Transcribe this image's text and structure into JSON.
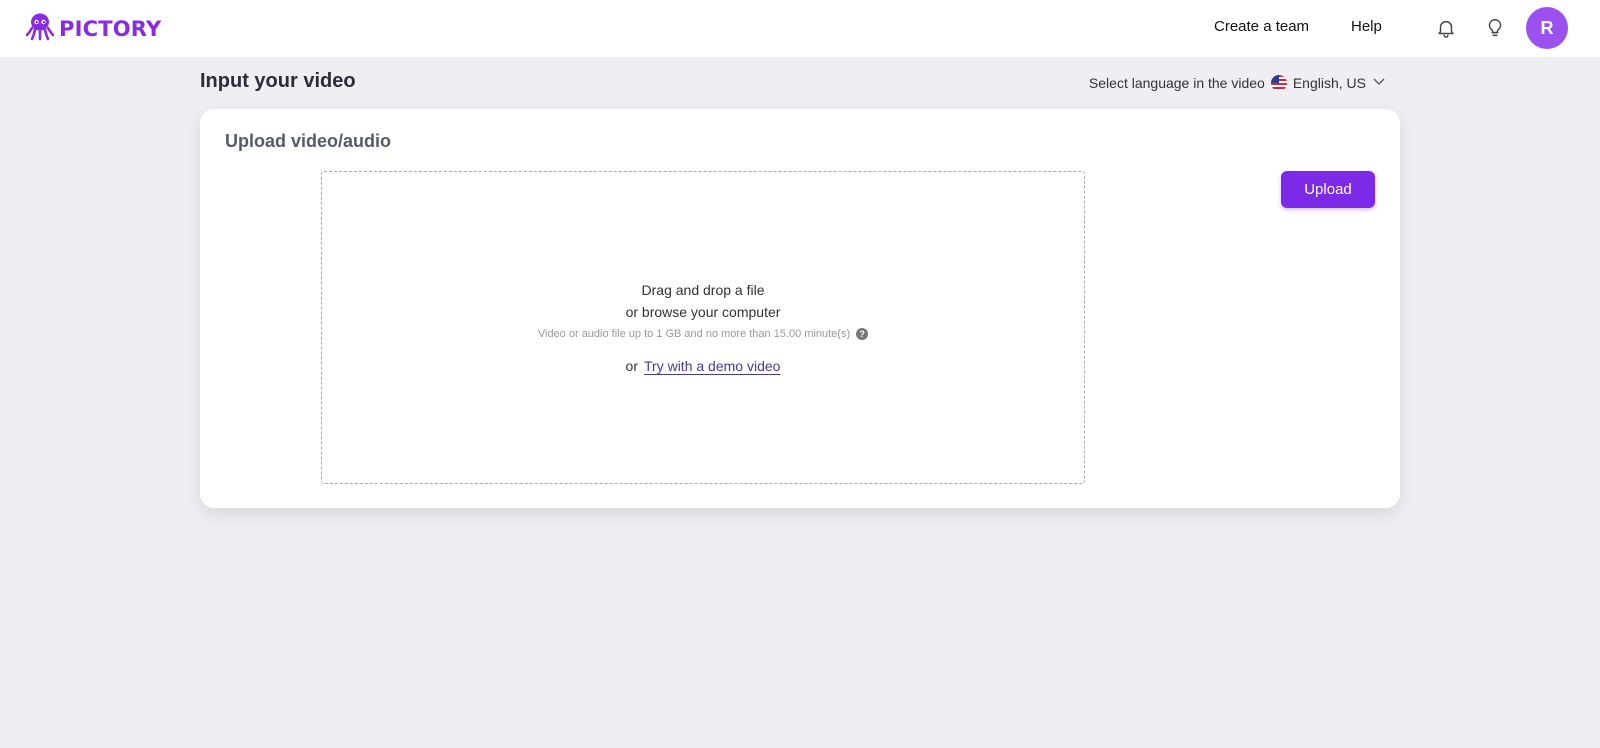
{
  "header": {
    "brand": "PICTORY",
    "nav": {
      "create_team": "Create a team",
      "help": "Help"
    },
    "icons": {
      "bell": "bell-icon",
      "bulb": "lightbulb-icon"
    },
    "avatar_initial": "R"
  },
  "page": {
    "title": "Input your video",
    "language_label": "Select language in the video",
    "language_value": "English, US"
  },
  "card": {
    "title": "Upload video/audio",
    "upload_label": "Upload",
    "dropzone": {
      "line1": "Drag and drop a file",
      "line2": "or browse your computer",
      "hint": "Video or audio file up to 1 GB and no more than 15.00 minute(s)",
      "or": "or",
      "demo_link": "Try with a demo video"
    }
  },
  "colors": {
    "accent": "#7d2ae8",
    "brand": "#8a2be2",
    "avatar": "#9b51f0"
  }
}
